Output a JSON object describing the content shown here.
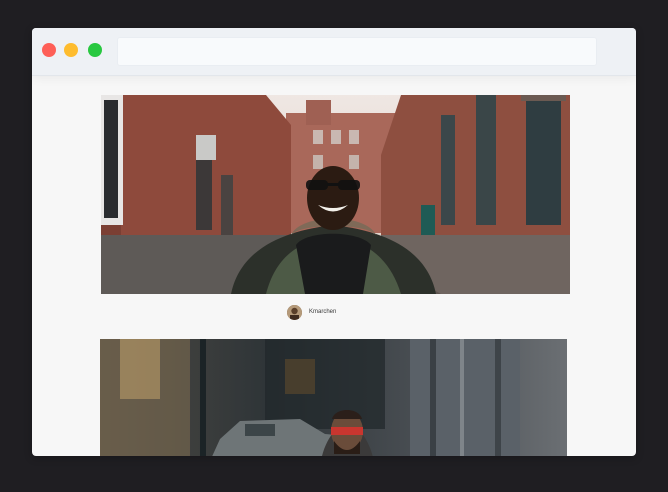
{
  "browser": {
    "buttons": {
      "close_color": "#fe5f57",
      "minimize_color": "#febc2e",
      "maximize_color": "#28c840"
    },
    "address_bar": {
      "value": ""
    }
  },
  "feed": {
    "posts": [
      {
        "image": "photo-man-smiling-in-alley",
        "author": {
          "username": "Kmarchen",
          "avatar": "avatar-image"
        }
      },
      {
        "image": "photo-man-with-red-headband-street"
      }
    ]
  }
}
